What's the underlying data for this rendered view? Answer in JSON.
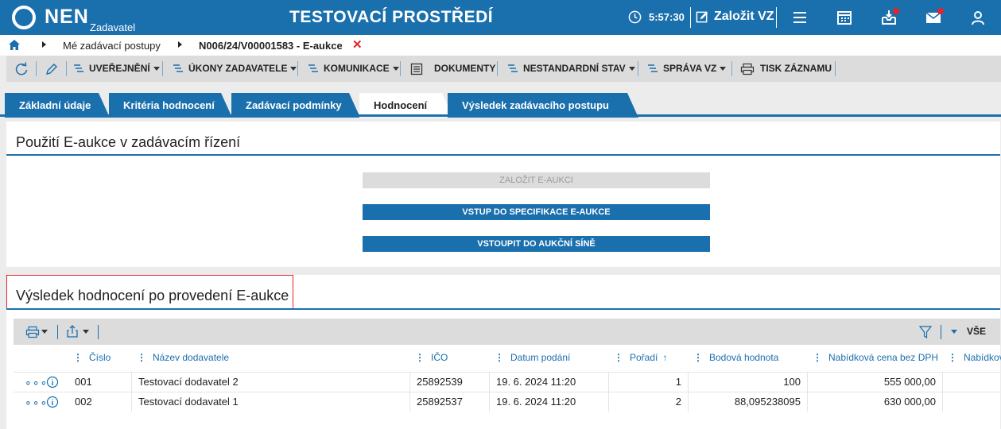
{
  "topbar": {
    "logo_text": "NEN",
    "logo_sub": "Zadavatel",
    "env_title": "TESTOVACÍ PROSTŘEDÍ",
    "clock": "5:57:30",
    "create_label": "Založit VZ",
    "icons": [
      "menu-icon",
      "calendar-icon",
      "inbox-icon",
      "mail-icon",
      "user-icon"
    ]
  },
  "breadcrumb": {
    "item1": "Mé zadávací postupy",
    "item2": "N006/24/V00001583 - E-aukce",
    "close": "✕"
  },
  "toolbar": {
    "uverejneni": "UVEŘEJNĚNÍ",
    "ukony": "ÚKONY ZADAVATELE",
    "komunikace": "KOMUNIKACE",
    "dokumenty": "DOKUMENTY",
    "nestandardni": "NESTANDARDNÍ STAV",
    "sprava": "SPRÁVA VZ",
    "tisk": "TISK ZÁZNAMU"
  },
  "tabs": [
    {
      "label": "Základní údaje"
    },
    {
      "label": "Kritéria hodnocení"
    },
    {
      "label": "Zadávací podmínky"
    },
    {
      "label": "Hodnocení"
    },
    {
      "label": "Výsledek zadávacího postupu"
    }
  ],
  "eauction": {
    "title": "Použití E-aukce v zadávacím řízení",
    "create_btn": "ZALOŽIT E-AUKCI",
    "spec_btn": "VSTUP DO SPECIFIKACE E-AUKCE",
    "room_btn": "VSTOUPIT DO AUKČNÍ SÍNĚ"
  },
  "results": {
    "title": "Výsledek hodnocení po provedení E-aukce",
    "filter_all": "VŠE",
    "columns": [
      "Číslo",
      "Název dodavatele",
      "IČO",
      "Datum podání",
      "Pořadí",
      "Bodová hodnota",
      "Nabídková cena bez DPH",
      "Nabídkov"
    ],
    "rows": [
      {
        "cislo": "001",
        "nazev": "Testovací dodavatel 2",
        "ico": "25892539",
        "datum": "19. 6. 2024 11:20",
        "poradi": "1",
        "body": "100",
        "cena": "555 000,00"
      },
      {
        "cislo": "002",
        "nazev": "Testovací dodavatel 1",
        "ico": "25892537",
        "datum": "19. 6. 2024 11:20",
        "poradi": "2",
        "body": "88,095238095",
        "cena": "630 000,00"
      }
    ]
  },
  "colors": {
    "brand": "#1a6fad",
    "alert": "#e3242b"
  }
}
